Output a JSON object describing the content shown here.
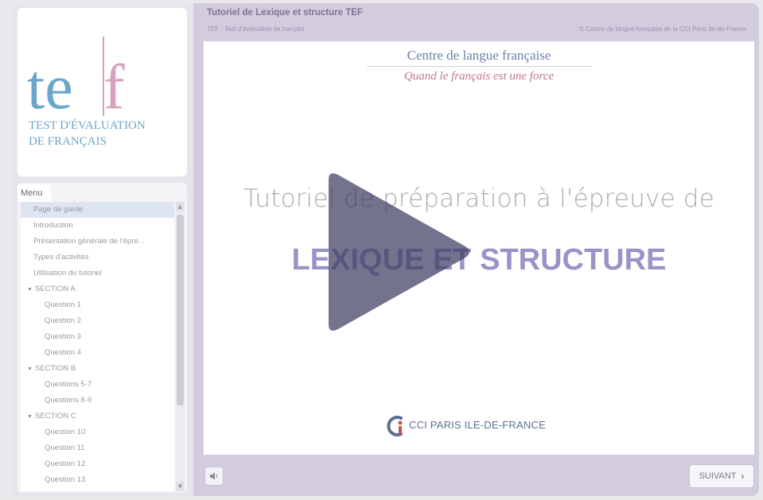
{
  "logo": {
    "mark_left": "te",
    "mark_right": "f",
    "line1": "TEST D'ÉVALUATION",
    "line2": "DE FRANÇAIS"
  },
  "menu": {
    "tab_label": "Menu",
    "items": [
      {
        "label": "Page de garde",
        "type": "item",
        "active": true
      },
      {
        "label": "Introduction",
        "type": "item"
      },
      {
        "label": "Présentation générale de l'épre...",
        "type": "item"
      },
      {
        "label": "Types d'activités",
        "type": "item"
      },
      {
        "label": "Utilisation du tutoriel",
        "type": "item"
      },
      {
        "label": "SECTION A",
        "type": "section"
      },
      {
        "label": "Question 1",
        "type": "sub"
      },
      {
        "label": "Question 2",
        "type": "sub"
      },
      {
        "label": "Question 3",
        "type": "sub"
      },
      {
        "label": "Question 4",
        "type": "sub"
      },
      {
        "label": "SECTION B",
        "type": "section"
      },
      {
        "label": "Questions 5-7",
        "type": "sub"
      },
      {
        "label": "Questions 8-9",
        "type": "sub"
      },
      {
        "label": "SECTION C",
        "type": "section"
      },
      {
        "label": "Question 10",
        "type": "sub"
      },
      {
        "label": "Question 11",
        "type": "sub"
      },
      {
        "label": "Question 12",
        "type": "sub"
      },
      {
        "label": "Question 13",
        "type": "sub"
      }
    ]
  },
  "header": {
    "title": "Tutoriel de Lexique et structure TEF",
    "subtitle": "TEF - Test d'évaluation de français",
    "copyright": "© Centre de langue française de la CCI Paris Ile-de-France"
  },
  "slide": {
    "brand_name": "Centre de langue française",
    "brand_tagline": "Quand le français est une force",
    "title": "Tutoriel de préparation à l'épreuve de",
    "subtitle": "LEXIQUE ET STRUCTURE",
    "footer_logo_text": "CCI PARIS ILE-DE-FRANCE"
  },
  "controls": {
    "next_label": "SUIVANT",
    "next_icon": "chevron-right-icon",
    "sound_icon": "speaker-icon",
    "play_icon": "play-icon"
  },
  "colors": {
    "frame": "#d3ccdf",
    "accent_purple": "#9994c6",
    "logo_blue": "#6aa6c9",
    "logo_pink": "#d9a1bd"
  }
}
